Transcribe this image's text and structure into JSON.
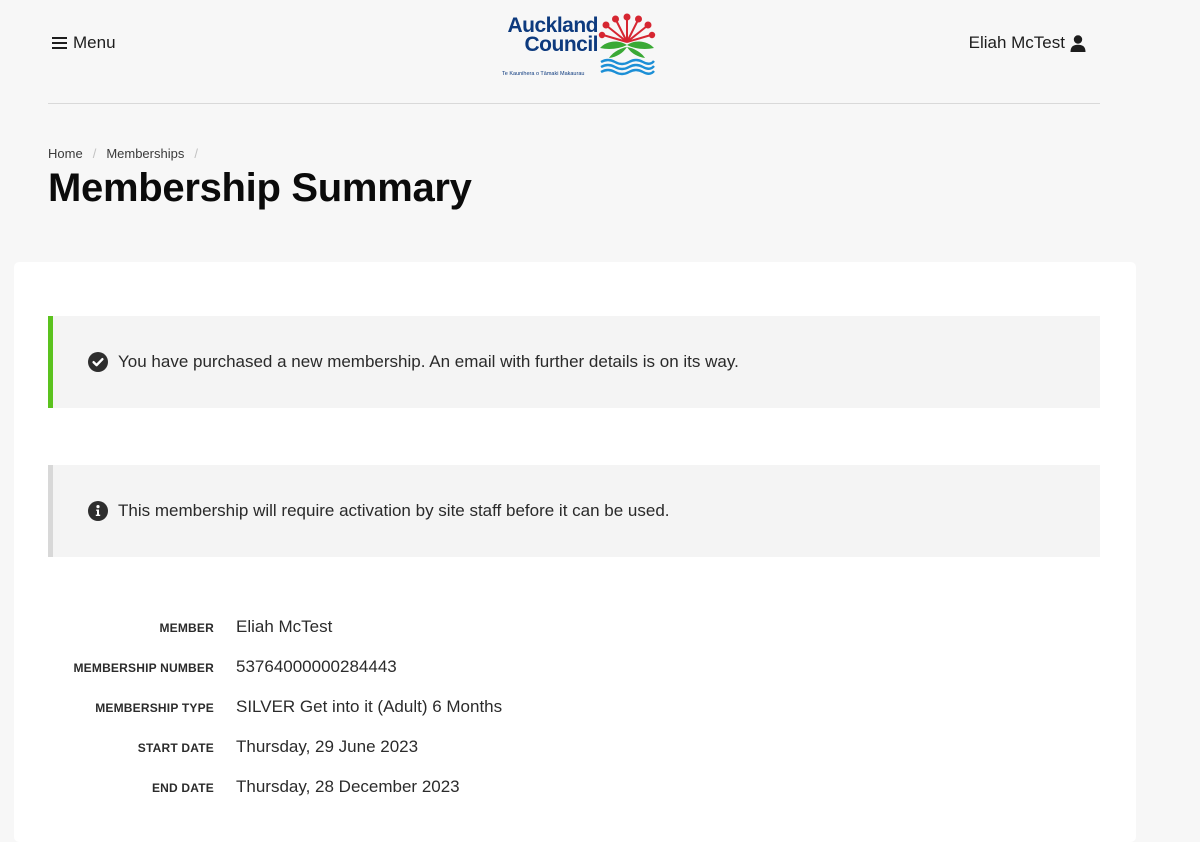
{
  "header": {
    "menu_label": "Menu",
    "user_name": "Eliah McTest",
    "logo": {
      "line1": "Auckland",
      "line2": "Council",
      "tagline": "Te Kaunihera o Tāmaki Makaurau",
      "brand_color": "#0d3a7e"
    }
  },
  "breadcrumb": {
    "items": [
      "Home",
      "Memberships"
    ]
  },
  "page_title": "Membership Summary",
  "alerts": {
    "success": {
      "icon": "check-circle-icon",
      "text": "You have purchased a new membership. An email with further details is on its way.",
      "accent_color": "#5bc21e"
    },
    "info": {
      "icon": "info-circle-icon",
      "text": "This membership will require activation by site staff before it can be used."
    }
  },
  "details": [
    {
      "label": "MEMBER",
      "value": "Eliah McTest"
    },
    {
      "label": "MEMBERSHIP NUMBER",
      "value": "53764000000284443"
    },
    {
      "label": "MEMBERSHIP TYPE",
      "value": "SILVER Get into it (Adult) 6 Months"
    },
    {
      "label": "START DATE",
      "value": "Thursday, 29 June 2023"
    },
    {
      "label": "END DATE",
      "value": "Thursday, 28 December 2023"
    }
  ]
}
